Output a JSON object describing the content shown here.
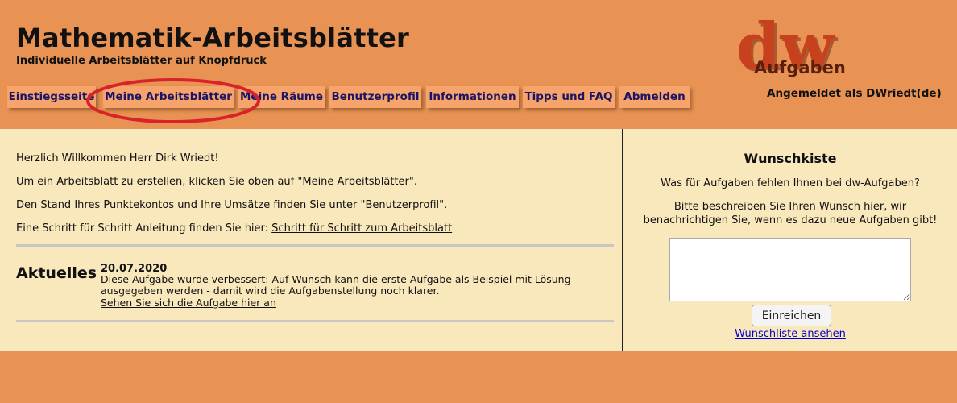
{
  "header": {
    "title": "Mathematik-Arbeitsblätter",
    "subtitle": "Individuelle Arbeitsblätter auf Knopfdruck",
    "login_status": "Angemeldet als DWriedt(de)",
    "logo": {
      "main": "dw",
      "sub": "Aufgaben",
      "color": "#c7411f"
    }
  },
  "nav": {
    "items": [
      {
        "label": "Einstiegsseite"
      },
      {
        "label": "Meine Arbeitsblätter"
      },
      {
        "label": "Meine Räume"
      },
      {
        "label": "Benutzerprofil"
      },
      {
        "label": "Informationen"
      },
      {
        "label": "Tipps und FAQ"
      },
      {
        "label": "Abmelden"
      }
    ],
    "highlight_color": "#d9232a"
  },
  "main": {
    "welcome": "Herzlich Willkommen Herr Dirk Wriedt!",
    "instruction": "Um ein Arbeitsblatt zu erstellen, klicken Sie oben auf \"Meine Arbeitsblätter\".",
    "points_info": "Den Stand Ihres Punktekontos und Ihre Umsätze finden Sie unter \"Benutzerprofil\".",
    "guide_prefix": "Eine Schritt für Schritt Anleitung finden Sie hier: ",
    "guide_link": "Schritt für Schritt zum Arbeitsblatt",
    "news": {
      "heading": "Aktuelles",
      "date": "20.07.2020",
      "text": "Diese Aufgabe wurde verbessert: Auf Wunsch kann die erste Aufgabe als Beispiel mit Lösung ausgegeben werden - damit wird die Aufgabenstellung noch klarer.",
      "link": "Sehen Sie sich die Aufgabe hier an"
    }
  },
  "sidebar": {
    "title": "Wunschkiste",
    "question": "Was für Aufgaben fehlen Ihnen bei dw-Aufgaben?",
    "description_line1": "Bitte beschreiben Sie Ihren Wunsch hier, wir",
    "description_line2": "benachrichtigen Sie, wenn es dazu neue Aufgaben gibt!",
    "input_value": "",
    "submit_label": "Einreichen",
    "wishlist_link": "Wunschliste ansehen"
  }
}
